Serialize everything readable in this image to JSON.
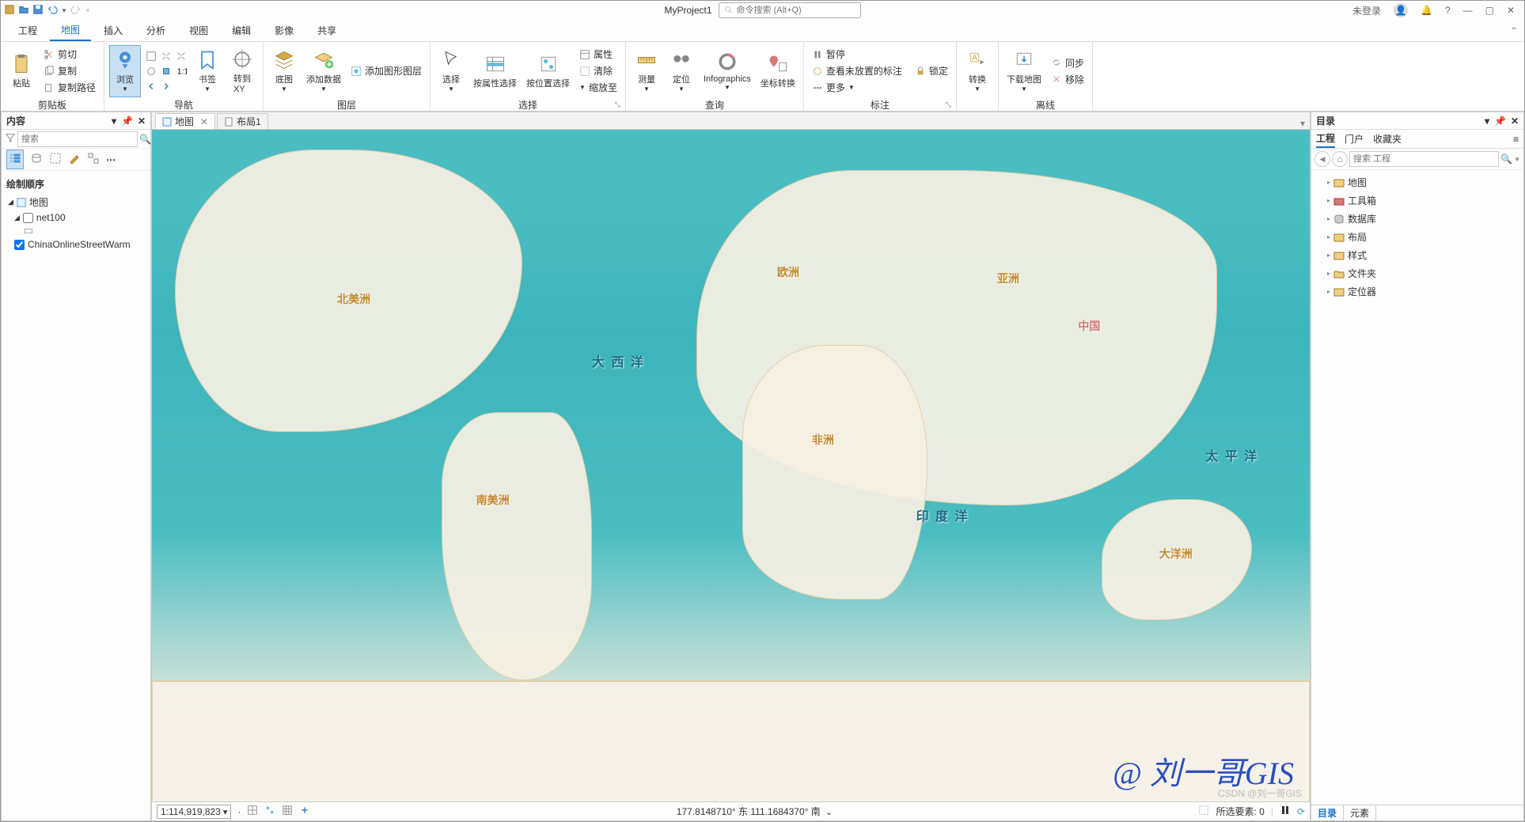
{
  "title_bar": {
    "project_name": "MyProject1",
    "search_placeholder": "命令搜索 (Alt+Q)",
    "login_status": "未登录"
  },
  "ribbon": {
    "tabs": [
      "工程",
      "地图",
      "插入",
      "分析",
      "视图",
      "编辑",
      "影像",
      "共享"
    ],
    "active_tab_index": 1,
    "groups": {
      "clipboard": {
        "label": "剪贴板",
        "paste": "粘贴",
        "cut": "剪切",
        "copy": "复制",
        "copy_path": "复制路径"
      },
      "navigate": {
        "label": "导航",
        "browse": "浏览",
        "bookmark": "书签",
        "goto_xy": "转到\nXY"
      },
      "layer": {
        "label": "图层",
        "basemap": "底图",
        "add_data": "添加数据",
        "add_graphics": "添加图形图层"
      },
      "select": {
        "label": "选择",
        "select": "选择",
        "select_by_attr": "按属性选择",
        "select_by_loc": "按位置选择",
        "attributes": "属性",
        "clear": "清除",
        "zoom_to": "缩放至"
      },
      "query": {
        "label": "查询",
        "measure": "测量",
        "locate": "定位",
        "infographics": "Infographics",
        "coord_convert": "坐标转换"
      },
      "annotation": {
        "label": "标注",
        "pause": "暂停",
        "lock": "锁定",
        "view_unplaced": "查看未放置的标注",
        "more": "更多"
      },
      "convert_group": {
        "label": "",
        "convert": "转换"
      },
      "offline": {
        "label": "离线",
        "download": "下载地图",
        "sync": "同步",
        "remove": "移除"
      }
    }
  },
  "contents_panel": {
    "title": "内容",
    "search_placeholder": "搜索",
    "drawing_order": "绘制顺序",
    "map_frame": "地图",
    "layers": [
      {
        "name": "net100",
        "checked": false
      },
      {
        "name": "ChinaOnlineStreetWarm",
        "checked": true
      }
    ]
  },
  "view_tabs": [
    {
      "name": "地图",
      "active": true
    },
    {
      "name": "布局1",
      "active": false
    }
  ],
  "map_labels": {
    "north_america": "北美洲",
    "south_america": "南美洲",
    "europe": "欧洲",
    "africa": "非洲",
    "asia": "亚洲",
    "china": "中国",
    "oceania": "大洋洲",
    "atlantic": "大 西 洋",
    "indian": "印 度 洋",
    "pacific": "太 平 洋"
  },
  "catalog_panel": {
    "title": "目录",
    "tabs": [
      "工程",
      "门户",
      "收藏夹"
    ],
    "active_tab": 0,
    "search_placeholder": "搜索 工程",
    "items": [
      "地图",
      "工具箱",
      "数据库",
      "布局",
      "样式",
      "文件夹",
      "定位器"
    ]
  },
  "status_bar": {
    "scale": "1:114,919,823",
    "coords": "177.8148710° 东 111.1684370° 南",
    "selected_count": "所选要素: 0"
  },
  "bottom_tabs": [
    "目录",
    "元素"
  ],
  "watermark": "@ 刘一哥GIS",
  "watermark2": "CSDN @刘一哥GIS"
}
